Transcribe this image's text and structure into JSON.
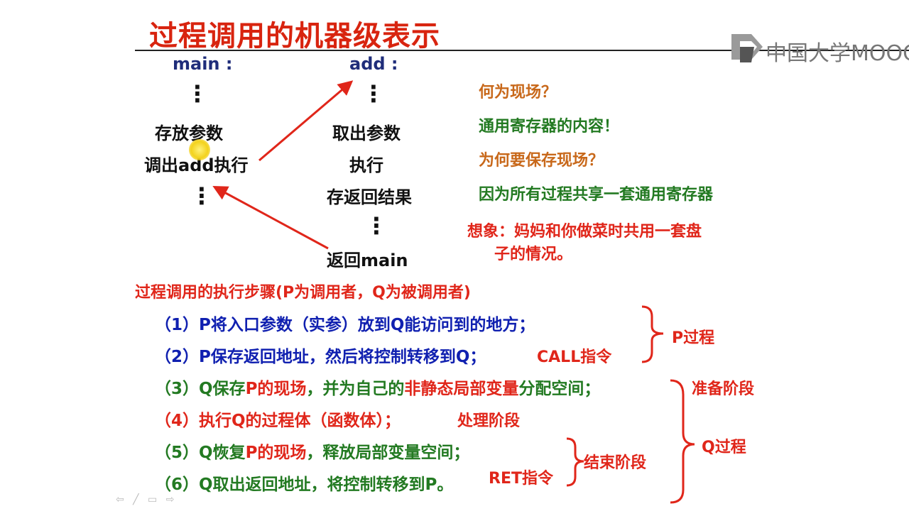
{
  "slide": {
    "title": "过程调用的机器级表示",
    "logo_text": "中国大学MOOC"
  },
  "diagram": {
    "main_label": "main :",
    "main_dots_top": "⋮",
    "main_store_params": "存放参数",
    "main_call": "调出add执行",
    "main_dots_bottom": "⋮",
    "add_label": "add :",
    "add_dots_top": "⋮",
    "add_get_params": "取出参数",
    "add_execute": "执行",
    "add_store_result": "存返回结果",
    "add_dots_bottom": "⋮",
    "add_return": "返回main"
  },
  "notes": {
    "q1": "何为现场？",
    "a1": "通用寄存器的内容！",
    "q2": "为何要保存现场？",
    "a2": "因为所有过程共享一套通用寄存器",
    "imagine_line1": "想象：妈妈和你做菜时共用一套盘",
    "imagine_line2": "子的情况。"
  },
  "steps": {
    "heading": "过程调用的执行步骤(P为调用者，Q为被调用者)",
    "s1": "（1）P将入口参数（实参）放到Q能访问到的地方；",
    "s2": "（2）P保存返回地址，然后将控制转移到Q；",
    "s2_tag": "CALL指令",
    "s3_a": "（3）Q保存",
    "s3_b": "P的现场",
    "s3_c": "，并为自己的",
    "s3_d": "非静态局部变量",
    "s3_e": "分配空间；",
    "s4": "（4）执行Q的过程体（函数体）；",
    "s4_tag": "处理阶段",
    "s5_a": "（5）Q恢复",
    "s5_b": "P的现场",
    "s5_c": "，释放局部变量空间；",
    "s6": "（6）Q取出返回地址，将控制转移到P。",
    "s6_tag": "RET指令",
    "p_process": "P过程",
    "prepare_phase": "准备阶段",
    "q_process": "Q过程",
    "end_phase": "结束阶段"
  },
  "toolbar": {
    "nav_icons": "⇦ ╱ ▭ ⇨"
  },
  "colors": {
    "title": "#d8240f",
    "navy": "#1f2d7a",
    "orange": "#c8681a",
    "green": "#237a22",
    "red": "#e0261a",
    "blue": "#1020b0"
  }
}
